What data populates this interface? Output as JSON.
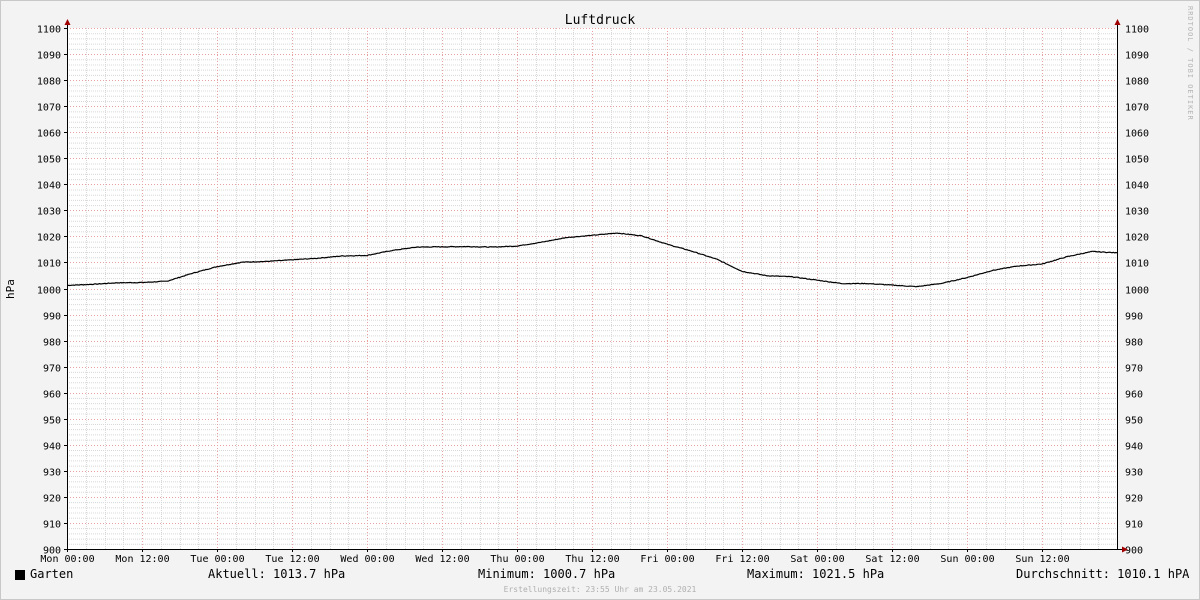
{
  "chart_data": {
    "type": "line",
    "title": "Luftdruck",
    "ylabel": "hPa",
    "ylim": [
      900,
      1100
    ],
    "y_ticks": [
      900,
      910,
      920,
      930,
      940,
      950,
      960,
      970,
      980,
      990,
      1000,
      1010,
      1020,
      1030,
      1040,
      1050,
      1060,
      1070,
      1080,
      1090,
      1100
    ],
    "x_tick_labels": [
      "Mon 00:00",
      "Mon 12:00",
      "Tue 00:00",
      "Tue 12:00",
      "Wed 00:00",
      "Wed 12:00",
      "Thu 00:00",
      "Thu 12:00",
      "Fri 00:00",
      "Fri 12:00",
      "Sat 00:00",
      "Sat 12:00",
      "Sun 00:00",
      "Sun 12:00"
    ],
    "x_unit": "hours since Mon 00:00",
    "xlim": [
      0,
      168
    ],
    "grid": true,
    "series": [
      {
        "name": "Garten",
        "color": "#000000",
        "x": [
          0,
          4,
          8,
          12,
          16,
          20,
          24,
          28,
          32,
          36,
          40,
          44,
          48,
          52,
          56,
          60,
          64,
          68,
          72,
          76,
          80,
          84,
          88,
          92,
          96,
          100,
          104,
          108,
          112,
          116,
          120,
          124,
          128,
          132,
          136,
          140,
          144,
          148,
          152,
          156,
          160,
          164,
          168
        ],
        "values": [
          1001.2,
          1001.6,
          1002.2,
          1002.3,
          1002.8,
          1005.8,
          1008.4,
          1010.1,
          1010.4,
          1011.0,
          1011.6,
          1012.5,
          1012.7,
          1014.6,
          1015.9,
          1016.0,
          1016.1,
          1015.9,
          1016.3,
          1017.8,
          1019.6,
          1020.4,
          1021.3,
          1020.2,
          1017.0,
          1014.3,
          1011.2,
          1006.6,
          1004.9,
          1004.5,
          1003.2,
          1001.9,
          1001.9,
          1001.3,
          1000.7,
          1002.0,
          1004.2,
          1006.9,
          1008.6,
          1009.4,
          1012.2,
          1014.2,
          1013.7
        ]
      }
    ]
  },
  "legend": {
    "series_name": "Garten",
    "current": "Aktuell: 1013.7 hPa",
    "minimum": "Minimum: 1000.7 hPa",
    "maximum": "Maximum: 1021.5 hPa",
    "average": "Durchschnitt: 1010.1 hPA"
  },
  "footer": "Erstellungszeit: 23:55 Uhr am 23.05.2021",
  "watermark": "RRDTOOL / TOBI OETIKER",
  "colors": {
    "background": "#f3f3f3",
    "plot_background": "#ffffff",
    "major_grid": "#e8a0a0",
    "minor_grid": "#d8d8d8",
    "axis_arrow": "#a00000",
    "line": "#000000"
  }
}
